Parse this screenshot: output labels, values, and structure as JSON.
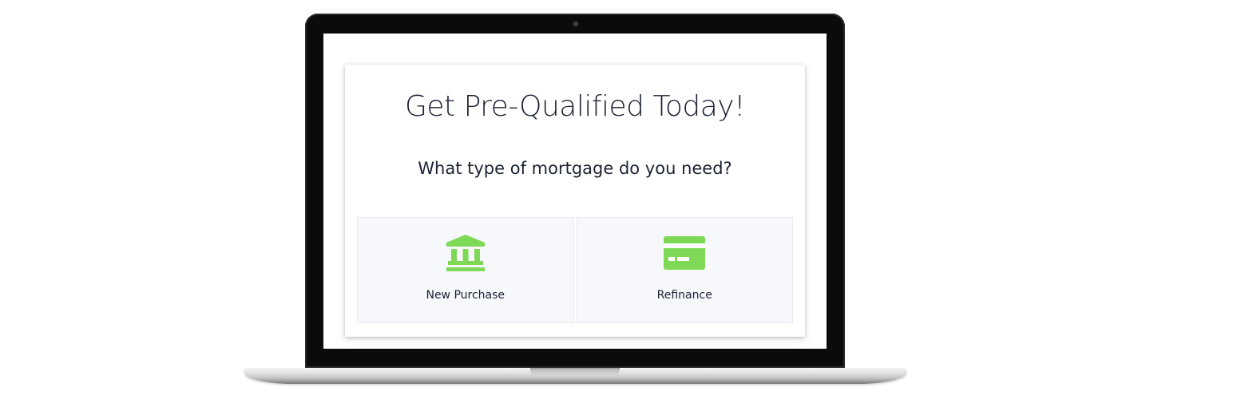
{
  "colors": {
    "accent": "#7ed957",
    "text": "#1c2233",
    "option_bg": "#f6f8fc"
  },
  "form": {
    "title": "Get Pre-Qualified Today!",
    "question": "What type of mortgage do you need?",
    "options": [
      {
        "label": "New Purchase",
        "icon": "bank-icon"
      },
      {
        "label": "Refinance",
        "icon": "credit-card-icon"
      }
    ]
  }
}
